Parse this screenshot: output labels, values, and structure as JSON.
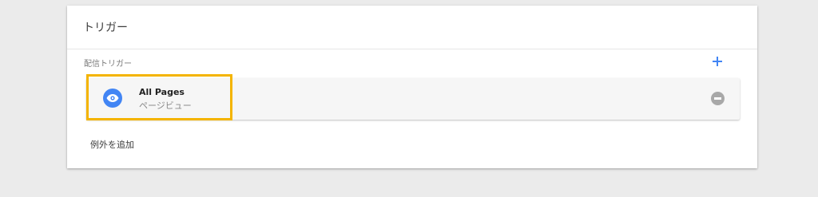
{
  "card": {
    "title": "トリガー"
  },
  "firing_triggers": {
    "label": "配信トリガー",
    "add_icon": "plus-icon",
    "items": [
      {
        "name": "All Pages",
        "type": "ページビュー",
        "icon": "eye-icon",
        "remove_icon": "remove-circle-icon"
      }
    ]
  },
  "exceptions": {
    "add_label": "例外を追加"
  },
  "colors": {
    "accent": "#4285f4",
    "highlight": "#f4b400",
    "background": "#ebebeb"
  }
}
